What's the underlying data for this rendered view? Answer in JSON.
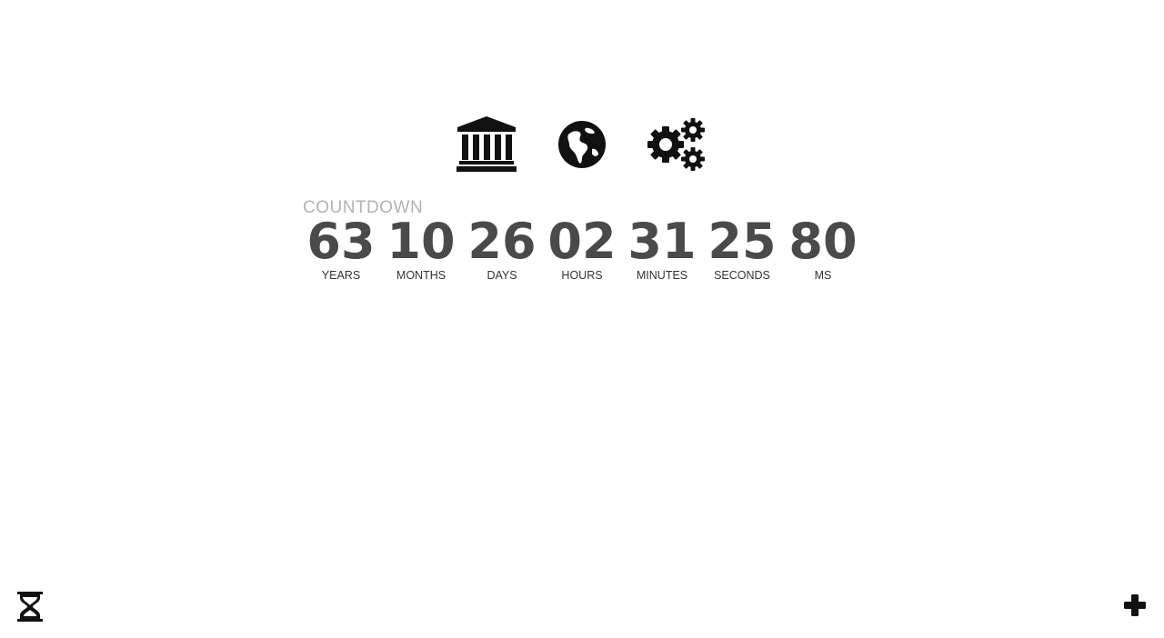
{
  "icons": {
    "top": [
      "museum-icon",
      "globe-icon",
      "gears-icon"
    ],
    "bottom_left": "hourglass-icon",
    "bottom_right": "plus-icon"
  },
  "countdown": {
    "label": "COUNTDOWN",
    "units": [
      {
        "value": "63",
        "label": "YEARS"
      },
      {
        "value": "10",
        "label": "MONTHS"
      },
      {
        "value": "26",
        "label": "DAYS"
      },
      {
        "value": "02",
        "label": "HOURS"
      },
      {
        "value": "31",
        "label": "MINUTES"
      },
      {
        "value": "25",
        "label": "SECONDS"
      },
      {
        "value": "80",
        "label": "MS"
      }
    ]
  },
  "colors": {
    "background": "#ffffff",
    "digits": "#4a4a4a",
    "label_muted": "#b3b3b3",
    "icon": "#111111"
  }
}
